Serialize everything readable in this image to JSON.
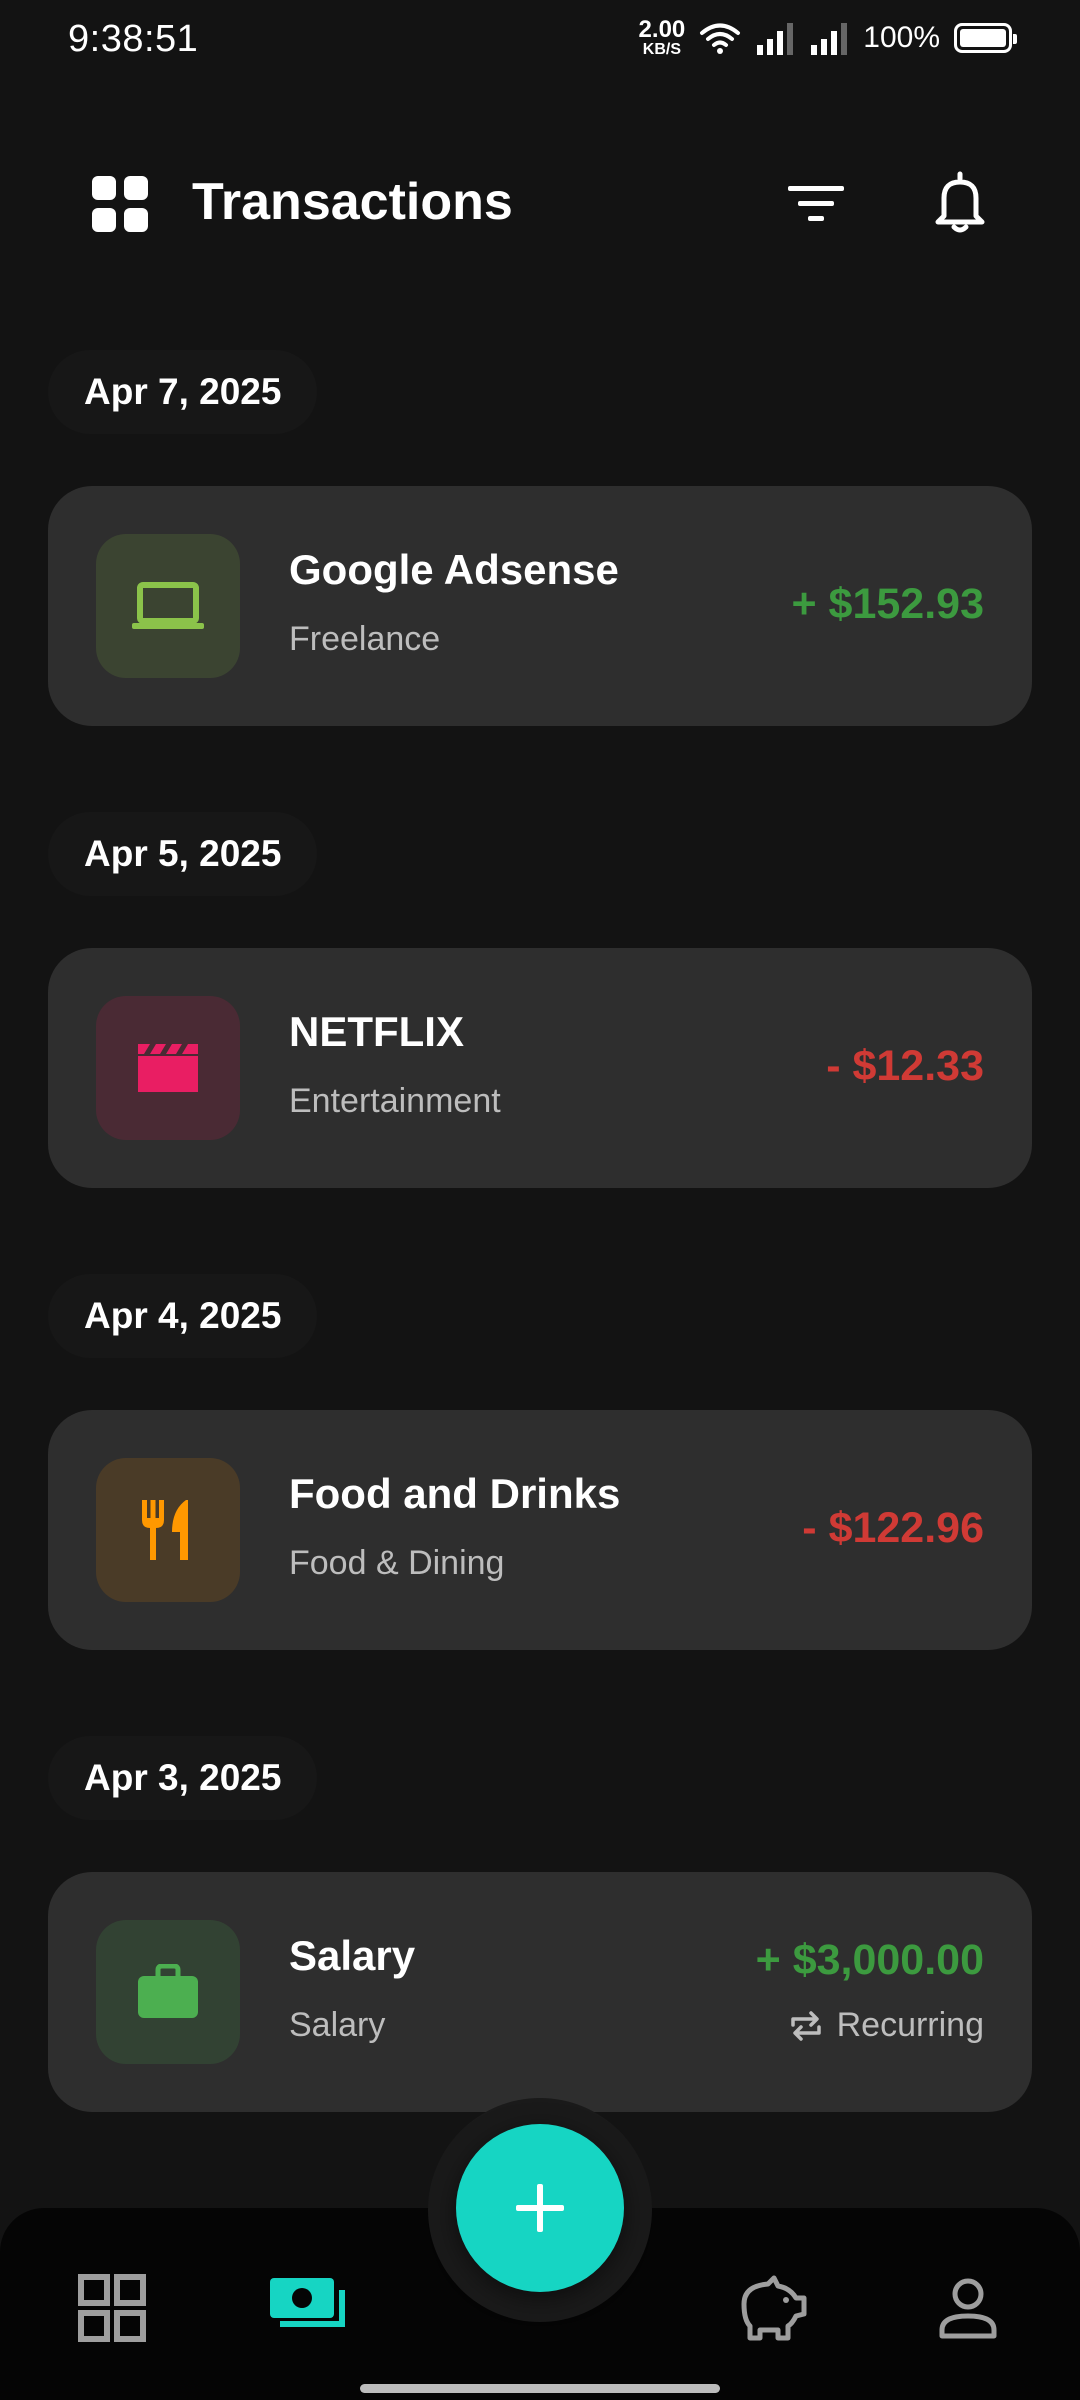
{
  "status_bar": {
    "time": "9:38:51",
    "net_speed_value": "2.00",
    "net_speed_unit": "KB/S",
    "battery": "100%"
  },
  "header": {
    "title": "Transactions",
    "icons": [
      "grid-icon",
      "filter-icon",
      "bell-icon"
    ]
  },
  "groups": [
    {
      "date": "Apr 7, 2025",
      "transaction": {
        "name": "Google Adsense",
        "category": "Freelance",
        "amount": "+ $152.93",
        "type": "income",
        "icon": "laptop-icon",
        "icon_color": "#8bc34a",
        "icon_bg": "#3b4431"
      }
    },
    {
      "date": "Apr 5, 2025",
      "transaction": {
        "name": "NETFLIX",
        "category": "Entertainment",
        "amount": "- $12.33",
        "type": "expense",
        "icon": "clapperboard-icon",
        "icon_color": "#e91e63",
        "icon_bg": "#4a2a34"
      }
    },
    {
      "date": "Apr 4, 2025",
      "transaction": {
        "name": "Food and Drinks",
        "category": "Food & Dining",
        "amount": "- $122.96",
        "type": "expense",
        "icon": "fork-knife-icon",
        "icon_color": "#ff9800",
        "icon_bg": "#4a3b27"
      }
    },
    {
      "date": "Apr 3, 2025",
      "transaction": {
        "name": "Salary",
        "category": "Salary",
        "amount": "+ $3,000.00",
        "type": "income",
        "icon": "briefcase-icon",
        "icon_color": "#4caf50",
        "icon_bg": "#324233",
        "recurring_label": "Recurring"
      }
    }
  ],
  "bottom_nav": {
    "items": [
      "dashboard-icon",
      "cash-icon",
      "piggy-bank-icon",
      "profile-icon"
    ],
    "active": "cash-icon"
  },
  "colors": {
    "background": "#131313",
    "card": "#2e2e2e",
    "income": "#3c9a3f",
    "expense": "#d03a35",
    "accent": "#16d5c3"
  }
}
